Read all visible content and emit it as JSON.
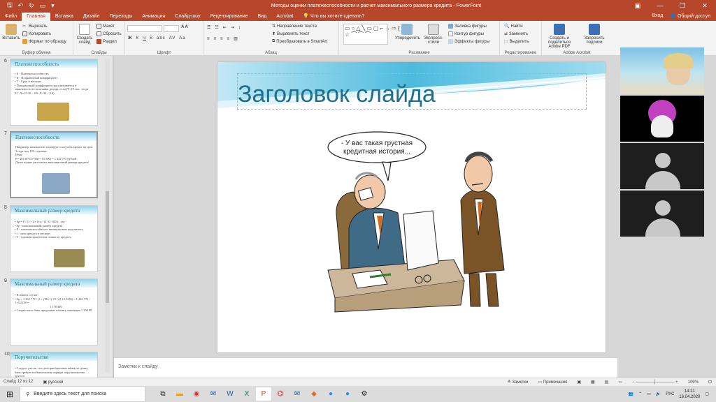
{
  "window": {
    "title": "Методы оценки платежеспособности и расчет максимального размера кредита - PowerPoint",
    "controls": [
      "—",
      "❐",
      "✕"
    ]
  },
  "ribbon_tabs": [
    "Файл",
    "Главная",
    "Вставка",
    "Дизайн",
    "Переходы",
    "Анимация",
    "Слайд-шоу",
    "Рецензирование",
    "Вид",
    "Acrobat"
  ],
  "tell_me": "Что вы хотите сделать?",
  "sign_in": "Вход",
  "share": "Общий доступ",
  "ribbon": {
    "clipboard": {
      "label": "Буфер обмена",
      "paste": "Вставить",
      "cut": "Вырезать",
      "copy": "Копировать",
      "format_painter": "Формат по образцу"
    },
    "slides": {
      "label": "Слайды",
      "new_slide": "Создать слайд",
      "layout": "Макет",
      "reset": "Сбросить",
      "section": "Раздел"
    },
    "font": {
      "label": "Шрифт"
    },
    "paragraph": {
      "label": "Абзац",
      "text_direction": "Направление текста",
      "align_text": "Выровнять текст",
      "smartart": "Преобразовать в SmartArt"
    },
    "drawing": {
      "label": "Рисование",
      "arrange": "Упорядочить",
      "quick_styles": "Экспресс-стили",
      "fill": "Заливка фигуры",
      "outline": "Контур фигуры",
      "effects": "Эффекты фигуры"
    },
    "editing": {
      "label": "Редактирование",
      "find": "Найти",
      "replace": "Заменить",
      "select": "Выделить"
    },
    "acrobat": {
      "label": "Adobe Acrobat",
      "create_share": "Создать и поделиться Adobe PDF",
      "request_sign": "Запросить подписи"
    }
  },
  "thumbnails": [
    {
      "num": "6",
      "title": "Платежеспособность",
      "lines": [
        "• Е - Платежеспособность",
        "• К - Поправочный коэффициент",
        "• Т - Срок в месяцах",
        "• Поправочный коэффициент рассчитывается в зависимости от величины дохода, если (Ч<15 тыс. тогда 0.7; Ч=15-30 – 0.8; Ч>30 – 0.9)"
      ]
    },
    {
      "num": "7",
      "title": "Платежеспособность",
      "lines": [
        "Например: наш клиент планирует получить кредит на срок 3 года под 15% годовых.",
        "Итак:",
        "Р= 40130*0,6*36(1+15/100) = 1 432 775 рублей.",
        "Далее нужно рассчитать максимальный размер кредита!"
      ]
    },
    {
      "num": "8",
      "title": "Максимальный размер кредита",
      "lines": [
        "• Sp = P / (1 + (t+1)·n / (2·12·100)) , где",
        "• Sp - максимальный размер кредита",
        "• Р - платежеспособность заемщика или поручителя",
        "• t - срок кредита в месяцах",
        "• Т - годовая процентная ставка по кредиту"
      ]
    },
    {
      "num": "9",
      "title": "Максимальный размер кредита",
      "lines": [
        "• В нашем случае:",
        "• Sp = 1 432 775 / (1 + (36+1)·15 / (2·12·100)) = 1 432 775 / 1+0,2158 =",
        "",
        "1 178 460",
        "• Скорее всего банк предложит клиенту максимум 1 100 00"
      ]
    },
    {
      "num": "10",
      "title": "Поручительство",
      "lines": [
        "• Следует учесть, что для приобретения займа на сумму, банк требует в обязательном порядке поручительство другого"
      ]
    }
  ],
  "slide": {
    "title": "Заголовок слайда",
    "speech": [
      "- У вас такая грустная",
      "кредитная история..."
    ]
  },
  "notes_placeholder": "Заметки к слайду",
  "status": {
    "slide_counter": "Слайд 12 из 12",
    "language": "русский",
    "notes": "Заметки",
    "comments": "Примечания",
    "zoom": "109%"
  },
  "taskbar": {
    "search_placeholder": "Введите здесь текст для поиска",
    "lang": "РУС",
    "time": "14:21",
    "date": "16.04.2020"
  },
  "colors": {
    "accent": "#b7472a",
    "title_blue": "#1e6f8c"
  }
}
